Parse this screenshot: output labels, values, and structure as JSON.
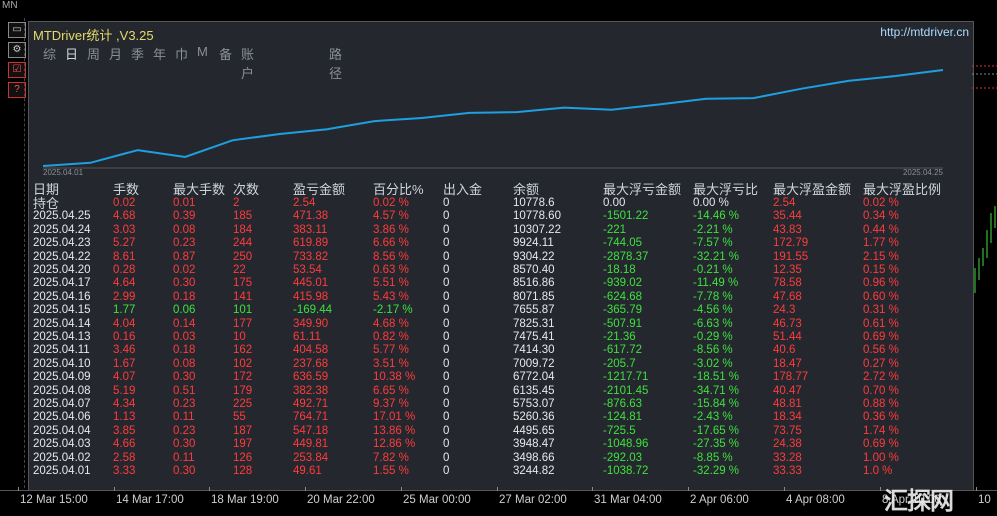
{
  "corner_label": "MN",
  "panel": {
    "title": "MTDriver统计 ,V3.25",
    "url": "http://mtdriver.cn"
  },
  "tabs": [
    "综",
    "日",
    "周",
    "月",
    "季",
    "年",
    "巾",
    "M",
    "备",
    "账户",
    "路径"
  ],
  "active_tab": 1,
  "chart": {
    "start_label": "2025.04.01",
    "end_label": "2025.04.25",
    "line_color": "#1e9fe0",
    "points": [
      3244.82,
      3498.66,
      4495.65,
      3948.47,
      5260.36,
      5753.07,
      6135.45,
      6772.04,
      7009.72,
      7414.3,
      7475.41,
      7825.31,
      7655.87,
      8071.85,
      8516.86,
      8570.4,
      9304.22,
      9924.11,
      10307.22,
      10778.6
    ]
  },
  "columns": [
    "日期",
    "手数",
    "最大手数",
    "次数",
    "盈亏金额",
    "百分比%",
    "出入金",
    "余额",
    "最大浮亏金额",
    "最大浮亏比",
    "最大浮盈金额",
    "最大浮盈比例"
  ],
  "colors": {
    "red": "#ff3b3b",
    "green": "#3fe03f",
    "white": "#e8e8e8"
  },
  "rows": [
    {
      "date": "持仓",
      "lots": "0.02",
      "max": "0.01",
      "count": "2",
      "pnl": "2.54",
      "pct": "0.02 %",
      "io": "0",
      "bal": "10778.6",
      "mfl": "0.00",
      "mfp": "0.00 %",
      "mfg": "2.54",
      "mgp": "0.02 %",
      "pos": true
    },
    {
      "date": "2025.04.25",
      "lots": "4.68",
      "max": "0.39",
      "count": "185",
      "pnl": "471.38",
      "pct": "4.57 %",
      "io": "0",
      "bal": "10778.60",
      "mfl": "-1501.22",
      "mfp": "-14.46 %",
      "mfg": "35.44",
      "mgp": "0.34 %",
      "pos": true
    },
    {
      "date": "2025.04.24",
      "lots": "3.03",
      "max": "0.08",
      "count": "184",
      "pnl": "383.11",
      "pct": "3.86 %",
      "io": "0",
      "bal": "10307.22",
      "mfl": "-221",
      "mfp": "-2.21 %",
      "mfg": "43.83",
      "mgp": "0.44 %",
      "pos": true
    },
    {
      "date": "2025.04.23",
      "lots": "5.27",
      "max": "0.23",
      "count": "244",
      "pnl": "619.89",
      "pct": "6.66 %",
      "io": "0",
      "bal": "9924.11",
      "mfl": "-744.05",
      "mfp": "-7.57 %",
      "mfg": "172.79",
      "mgp": "1.77 %",
      "pos": true
    },
    {
      "date": "2025.04.22",
      "lots": "8.61",
      "max": "0.87",
      "count": "250",
      "pnl": "733.82",
      "pct": "8.56 %",
      "io": "0",
      "bal": "9304.22",
      "mfl": "-2878.37",
      "mfp": "-32.21 %",
      "mfg": "191.55",
      "mgp": "2.15 %",
      "pos": true
    },
    {
      "date": "2025.04.20",
      "lots": "0.28",
      "max": "0.02",
      "count": "22",
      "pnl": "53.54",
      "pct": "0.63 %",
      "io": "0",
      "bal": "8570.40",
      "mfl": "-18.18",
      "mfp": "-0.21 %",
      "mfg": "12.35",
      "mgp": "0.15 %",
      "pos": true
    },
    {
      "date": "2025.04.17",
      "lots": "4.64",
      "max": "0.30",
      "count": "175",
      "pnl": "445.01",
      "pct": "5.51 %",
      "io": "0",
      "bal": "8516.86",
      "mfl": "-939.02",
      "mfp": "-11.49 %",
      "mfg": "78.58",
      "mgp": "0.96 %",
      "pos": true
    },
    {
      "date": "2025.04.16",
      "lots": "2.99",
      "max": "0.18",
      "count": "141",
      "pnl": "415.98",
      "pct": "5.43 %",
      "io": "0",
      "bal": "8071.85",
      "mfl": "-624.68",
      "mfp": "-7.78 %",
      "mfg": "47.68",
      "mgp": "0.60 %",
      "pos": true
    },
    {
      "date": "2025.04.15",
      "lots": "1.77",
      "max": "0.06",
      "count": "101",
      "pnl": "-169.44",
      "pct": "-2.17 %",
      "io": "0",
      "bal": "7655.87",
      "mfl": "-365.79",
      "mfp": "-4.56 %",
      "mfg": "24.3",
      "mgp": "0.31 %",
      "pos": false
    },
    {
      "date": "2025.04.14",
      "lots": "4.04",
      "max": "0.14",
      "count": "177",
      "pnl": "349.90",
      "pct": "4.68 %",
      "io": "0",
      "bal": "7825.31",
      "mfl": "-507.91",
      "mfp": "-6.63 %",
      "mfg": "46.73",
      "mgp": "0.61 %",
      "pos": true
    },
    {
      "date": "2025.04.13",
      "lots": "0.16",
      "max": "0.03",
      "count": "10",
      "pnl": "61.11",
      "pct": "0.82 %",
      "io": "0",
      "bal": "7475.41",
      "mfl": "-21.36",
      "mfp": "-0.29 %",
      "mfg": "51.44",
      "mgp": "0.69 %",
      "pos": true
    },
    {
      "date": "2025.04.11",
      "lots": "3.46",
      "max": "0.18",
      "count": "162",
      "pnl": "404.58",
      "pct": "5.77 %",
      "io": "0",
      "bal": "7414.30",
      "mfl": "-617.72",
      "mfp": "-8.56 %",
      "mfg": "40.6",
      "mgp": "0.56 %",
      "pos": true
    },
    {
      "date": "2025.04.10",
      "lots": "1.67",
      "max": "0.08",
      "count": "102",
      "pnl": "237.68",
      "pct": "3.51 %",
      "io": "0",
      "bal": "7009.72",
      "mfl": "-205.7",
      "mfp": "-3.02 %",
      "mfg": "18.47",
      "mgp": "0.27 %",
      "pos": true
    },
    {
      "date": "2025.04.09",
      "lots": "4.07",
      "max": "0.30",
      "count": "172",
      "pnl": "636.59",
      "pct": "10.38 %",
      "io": "0",
      "bal": "6772.04",
      "mfl": "-1217.71",
      "mfp": "-18.51 %",
      "mfg": "178.77",
      "mgp": "2.72 %",
      "pos": true
    },
    {
      "date": "2025.04.08",
      "lots": "5.19",
      "max": "0.51",
      "count": "179",
      "pnl": "382.38",
      "pct": "6.65 %",
      "io": "0",
      "bal": "6135.45",
      "mfl": "-2101.45",
      "mfp": "-34.71 %",
      "mfg": "40.47",
      "mgp": "0.70 %",
      "pos": true
    },
    {
      "date": "2025.04.07",
      "lots": "4.34",
      "max": "0.23",
      "count": "225",
      "pnl": "492.71",
      "pct": "9.37 %",
      "io": "0",
      "bal": "5753.07",
      "mfl": "-876.63",
      "mfp": "-15.84 %",
      "mfg": "48.81",
      "mgp": "0.88 %",
      "pos": true
    },
    {
      "date": "2025.04.06",
      "lots": "1.13",
      "max": "0.11",
      "count": "55",
      "pnl": "764.71",
      "pct": "17.01 %",
      "io": "0",
      "bal": "5260.36",
      "mfl": "-124.81",
      "mfp": "-2.43 %",
      "mfg": "18.34",
      "mgp": "0.36 %",
      "pos": true
    },
    {
      "date": "2025.04.04",
      "lots": "3.85",
      "max": "0.23",
      "count": "187",
      "pnl": "547.18",
      "pct": "13.86 %",
      "io": "0",
      "bal": "4495.65",
      "mfl": "-725.5",
      "mfp": "-17.65 %",
      "mfg": "73.75",
      "mgp": "1.74 %",
      "pos": true
    },
    {
      "date": "2025.04.03",
      "lots": "4.66",
      "max": "0.30",
      "count": "197",
      "pnl": "449.81",
      "pct": "12.86 %",
      "io": "0",
      "bal": "3948.47",
      "mfl": "-1048.96",
      "mfp": "-27.35 %",
      "mfg": "24.38",
      "mgp": "0.69 %",
      "pos": true
    },
    {
      "date": "2025.04.02",
      "lots": "2.58",
      "max": "0.11",
      "count": "126",
      "pnl": "253.84",
      "pct": "7.82 %",
      "io": "0",
      "bal": "3498.66",
      "mfl": "-292.03",
      "mfp": "-8.85 %",
      "mfg": "33.28",
      "mgp": "1.00 %",
      "pos": true
    },
    {
      "date": "2025.04.01",
      "lots": "3.33",
      "max": "0.30",
      "count": "128",
      "pnl": "49.61",
      "pct": "1.55 %",
      "io": "0",
      "bal": "3244.82",
      "mfl": "-1038.72",
      "mfp": "-32.29 %",
      "mfg": "33.33",
      "mgp": "1.0 %",
      "pos": true
    }
  ],
  "axis_ticks": [
    "12 Mar 15:00",
    "14 Mar 17:00",
    "18 Mar 19:00",
    "20 Mar 22:00",
    "25 Mar 00:00",
    "27 Mar 02:00",
    "31 Mar 04:00",
    "2 Apr 06:00",
    "4 Apr 08:00",
    "8 Apr 10:00",
    "10"
  ],
  "watermark": "汇探网"
}
